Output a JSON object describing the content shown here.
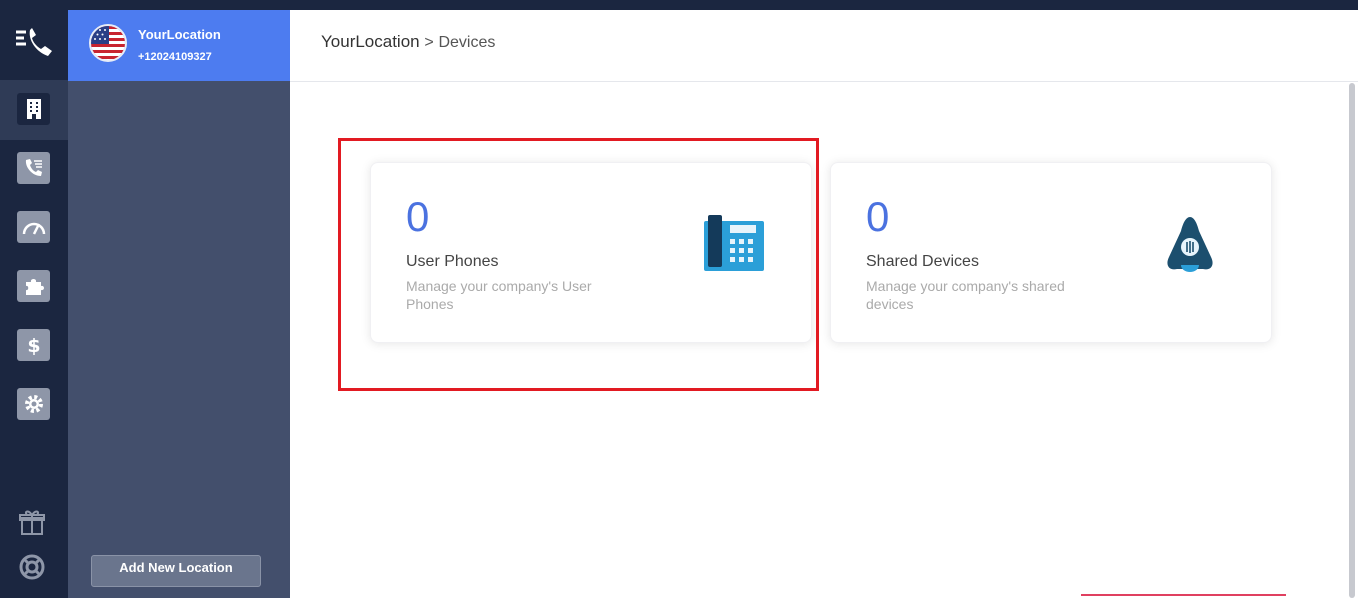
{
  "breadcrumb": {
    "root": "YourLocation",
    "separator": ">",
    "current": "Devices"
  },
  "location": {
    "name": "YourLocation",
    "phone": "+12024109327",
    "flag": "us-flag-icon"
  },
  "sidebar": {
    "add_location_label": "Add New Location"
  },
  "rail": {
    "items": [
      {
        "name": "building-icon",
        "active": true
      },
      {
        "name": "phone-calls-icon",
        "active": false
      },
      {
        "name": "gauge-icon",
        "active": false
      },
      {
        "name": "puzzle-icon",
        "active": false
      },
      {
        "name": "dollar-icon",
        "active": false
      },
      {
        "name": "gear-icon",
        "active": false
      }
    ],
    "bottom": [
      "gift-icon",
      "lifebuoy-icon"
    ]
  },
  "cards": [
    {
      "count": "0",
      "title": "User Phones",
      "description": "Manage your company's User Phones",
      "icon": "desk-phone-icon"
    },
    {
      "count": "0",
      "title": "Shared Devices",
      "description": "Manage your company's shared devices",
      "icon": "conference-phone-icon"
    }
  ],
  "colors": {
    "accent": "#4d7cf0",
    "rail": "#1b2640",
    "panel": "#434f6c",
    "count": "#4b72e0",
    "highlight": "#e21a22"
  }
}
